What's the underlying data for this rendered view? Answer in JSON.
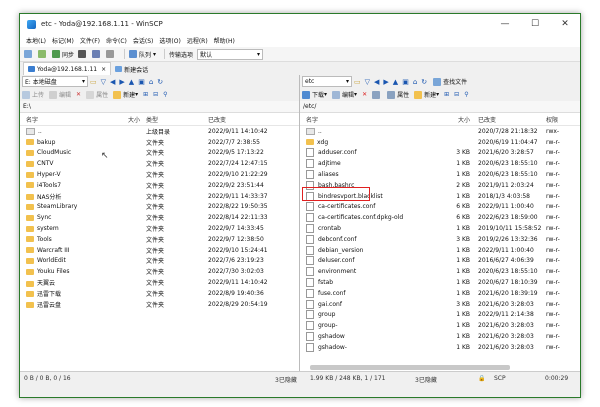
{
  "title": "etc - Yoda@192.168.1.11 - WinSCP",
  "menu": [
    "本地(L)",
    "标记(M)",
    "文件(F)",
    "命令(C)",
    "会话(S)",
    "选项(O)",
    "远程(R)",
    "帮助(H)"
  ],
  "toolbar": {
    "sync": "同步",
    "queue": "队列",
    "transfer_label": "传输选项",
    "transfer_value": "默认"
  },
  "tabs": [
    {
      "label": "Yoda@192.168.1.11"
    },
    {
      "label": "新建会话"
    }
  ],
  "left": {
    "drive": "E: 本地磁盘",
    "actions": {
      "upload": "上传",
      "edit": "编辑",
      "props": "属性",
      "new": "新建"
    },
    "path": "E:\\",
    "headers": {
      "name": "名字",
      "size": "大小",
      "type": "类型",
      "changed": "已改变"
    },
    "rows": [
      {
        "name": "..",
        "size": "",
        "type": "上级目录",
        "changed": "2022/9/11 14:10:42",
        "icon": "up"
      },
      {
        "name": "bakup",
        "size": "",
        "type": "文件夹",
        "changed": "2022/7/7 2:38:55",
        "icon": "folder"
      },
      {
        "name": "CloudMusic",
        "size": "",
        "type": "文件夹",
        "changed": "2022/9/5 17:13:22",
        "icon": "folder"
      },
      {
        "name": "CNTV",
        "size": "",
        "type": "文件夹",
        "changed": "2022/7/24 12:47:15",
        "icon": "folder"
      },
      {
        "name": "Hyper-V",
        "size": "",
        "type": "文件夹",
        "changed": "2022/9/10 21:22:29",
        "icon": "folder"
      },
      {
        "name": "i4Tools7",
        "size": "",
        "type": "文件夹",
        "changed": "2022/9/2 23:51:44",
        "icon": "folder"
      },
      {
        "name": "NAS分析",
        "size": "",
        "type": "文件夹",
        "changed": "2022/9/11 14:33:37",
        "icon": "folder"
      },
      {
        "name": "SteamLibrary",
        "size": "",
        "type": "文件夹",
        "changed": "2022/8/22 19:50:35",
        "icon": "folder"
      },
      {
        "name": "Sync",
        "size": "",
        "type": "文件夹",
        "changed": "2022/8/14 22:11:33",
        "icon": "folder"
      },
      {
        "name": "system",
        "size": "",
        "type": "文件夹",
        "changed": "2022/9/7 14:33:45",
        "icon": "folder"
      },
      {
        "name": "Tools",
        "size": "",
        "type": "文件夹",
        "changed": "2022/9/7 12:38:50",
        "icon": "folder"
      },
      {
        "name": "Warcraft III",
        "size": "",
        "type": "文件夹",
        "changed": "2022/9/10 15:24:41",
        "icon": "folder"
      },
      {
        "name": "WorldEdit",
        "size": "",
        "type": "文件夹",
        "changed": "2022/7/6 23:19:23",
        "icon": "folder"
      },
      {
        "name": "Youku Files",
        "size": "",
        "type": "文件夹",
        "changed": "2022/7/30 3:02:03",
        "icon": "folder"
      },
      {
        "name": "天翼云",
        "size": "",
        "type": "文件夹",
        "changed": "2022/9/11 14:10:42",
        "icon": "folder"
      },
      {
        "name": "迅雷下载",
        "size": "",
        "type": "文件夹",
        "changed": "2022/8/9 19:40:36",
        "icon": "folder"
      },
      {
        "name": "迅雷云盘",
        "size": "",
        "type": "文件夹",
        "changed": "2022/8/29 20:54:19",
        "icon": "folder"
      }
    ]
  },
  "right": {
    "dir": "etc",
    "actions": {
      "download": "下载",
      "edit": "编辑",
      "props": "属性",
      "new": "新建",
      "find": "查找文件"
    },
    "path": "/etc/",
    "headers": {
      "name": "名字",
      "size": "大小",
      "changed": "已改变",
      "perm": "权限"
    },
    "rows": [
      {
        "name": "..",
        "size": "",
        "changed": "2020/7/28 21:18:32",
        "perm": "rwx-",
        "icon": "up"
      },
      {
        "name": "xdg",
        "size": "",
        "changed": "2020/6/19 11:04:47",
        "perm": "rw-r-",
        "icon": "folder"
      },
      {
        "name": "adduser.conf",
        "size": "3 KB",
        "changed": "2021/6/20 3:28:57",
        "perm": "rw-r-",
        "icon": "doc"
      },
      {
        "name": "adjtime",
        "size": "1 KB",
        "changed": "2020/6/23 18:55:10",
        "perm": "rw-r-",
        "icon": "doc"
      },
      {
        "name": "aliases",
        "size": "1 KB",
        "changed": "2020/6/23 18:55:10",
        "perm": "rw-r-",
        "icon": "doc"
      },
      {
        "name": "bash.bashrc",
        "size": "2 KB",
        "changed": "2021/9/11 2:03:24",
        "perm": "rw-r-",
        "icon": "doc"
      },
      {
        "name": "bindresvport.blacklist",
        "size": "1 KB",
        "changed": "2018/1/3 4:03:58",
        "perm": "rw-r-",
        "icon": "doc"
      },
      {
        "name": "ca-certificates.conf",
        "size": "6 KB",
        "changed": "2022/9/11 1:00:40",
        "perm": "rw-r-",
        "icon": "doc"
      },
      {
        "name": "ca-certificates.conf.dpkg-old",
        "size": "6 KB",
        "changed": "2022/6/23 18:59:00",
        "perm": "rw-r-",
        "icon": "doc"
      },
      {
        "name": "crontab",
        "size": "1 KB",
        "changed": "2019/10/11 15:58:52",
        "perm": "rw-r-",
        "icon": "doc"
      },
      {
        "name": "debconf.conf",
        "size": "3 KB",
        "changed": "2019/2/26 13:32:36",
        "perm": "rw-r-",
        "icon": "doc"
      },
      {
        "name": "debian_version",
        "size": "1 KB",
        "changed": "2022/9/11 1:00:40",
        "perm": "rw-r-",
        "icon": "doc"
      },
      {
        "name": "deluser.conf",
        "size": "1 KB",
        "changed": "2016/6/27 4:06:39",
        "perm": "rw-r-",
        "icon": "doc"
      },
      {
        "name": "environment",
        "size": "1 KB",
        "changed": "2020/6/23 18:55:10",
        "perm": "rw-r-",
        "icon": "doc"
      },
      {
        "name": "fstab",
        "size": "1 KB",
        "changed": "2020/6/27 18:10:39",
        "perm": "rw-r-",
        "icon": "doc"
      },
      {
        "name": "fuse.conf",
        "size": "1 KB",
        "changed": "2021/6/20 18:39:19",
        "perm": "rw-r-",
        "icon": "doc"
      },
      {
        "name": "gai.conf",
        "size": "3 KB",
        "changed": "2021/6/20 3:28:03",
        "perm": "rw-r-",
        "icon": "doc"
      },
      {
        "name": "group",
        "size": "1 KB",
        "changed": "2022/9/11 2:14:38",
        "perm": "rw-r-",
        "icon": "doc"
      },
      {
        "name": "group-",
        "size": "1 KB",
        "changed": "2021/6/20 3:28:03",
        "perm": "rw-r-",
        "icon": "doc"
      },
      {
        "name": "gshadow",
        "size": "1 KB",
        "changed": "2021/6/20 3:28:03",
        "perm": "rw-r-",
        "icon": "doc"
      },
      {
        "name": "gshadow-",
        "size": "1 KB",
        "changed": "2021/6/20 3:28:03",
        "perm": "rw-r-",
        "icon": "doc"
      }
    ]
  },
  "status": {
    "left": "0 B / 0 B,  0 / 16",
    "hidden": "3已隐藏",
    "right": "1.99 KB / 248 KB,  1 / 171",
    "hidden_right": "3已隐藏",
    "protocol": "SCP",
    "time": "0:00:29"
  },
  "colors": {
    "folder": "#f2c14e",
    "highlight": "#e02020",
    "accent": "#1a56b0"
  }
}
